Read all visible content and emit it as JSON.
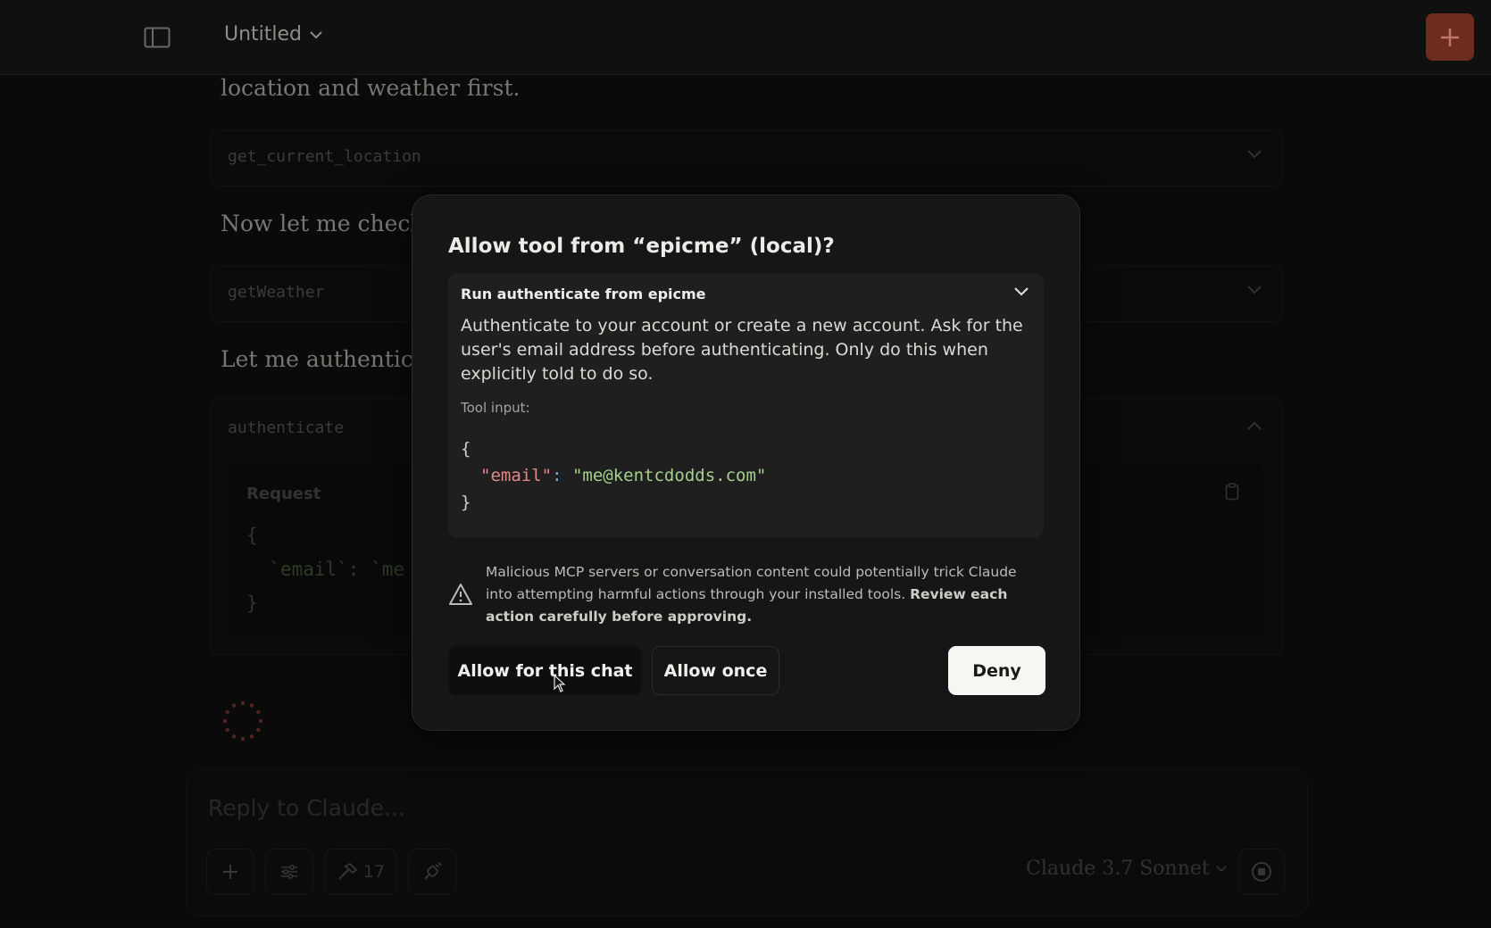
{
  "header": {
    "title": "Untitled"
  },
  "conversation": {
    "line1": "location and weather first.",
    "line2": "Now let me check",
    "line3": "Let me authentica",
    "tool1": "get_current_location",
    "tool2": "getWeather",
    "tool3": "authenticate",
    "request_label": "Request",
    "request_open": "{",
    "request_body_key": "`email`: `me",
    "request_close": "}"
  },
  "composer": {
    "placeholder": "Reply to Claude...",
    "tools_count": "17",
    "model": "Claude 3.7 Sonnet"
  },
  "modal": {
    "title": "Allow tool from “epicme” (local)?",
    "detail_header": "Run authenticate from epicme",
    "description": "Authenticate to your account or create a new account. Ask for the user's email address before authenticating. Only do this when explicitly told to do so.",
    "tool_input_label": "Tool input:",
    "code": {
      "open": "{",
      "key": "\"email\"",
      "colon": ":",
      "value": "\"me@kentcdodds.com\"",
      "close": "}"
    },
    "warning_text": "Malicious MCP servers or conversation content could potentially trick Claude into attempting harmful actions through your installed tools.",
    "warning_strong": "Review each action carefully before approving.",
    "buttons": {
      "allow_chat": "Allow for this chat",
      "allow_once": "Allow once",
      "deny": "Deny"
    }
  },
  "colors": {
    "accent": "#6e2c1f",
    "background": "#101010",
    "modal_bg": "#161616"
  }
}
